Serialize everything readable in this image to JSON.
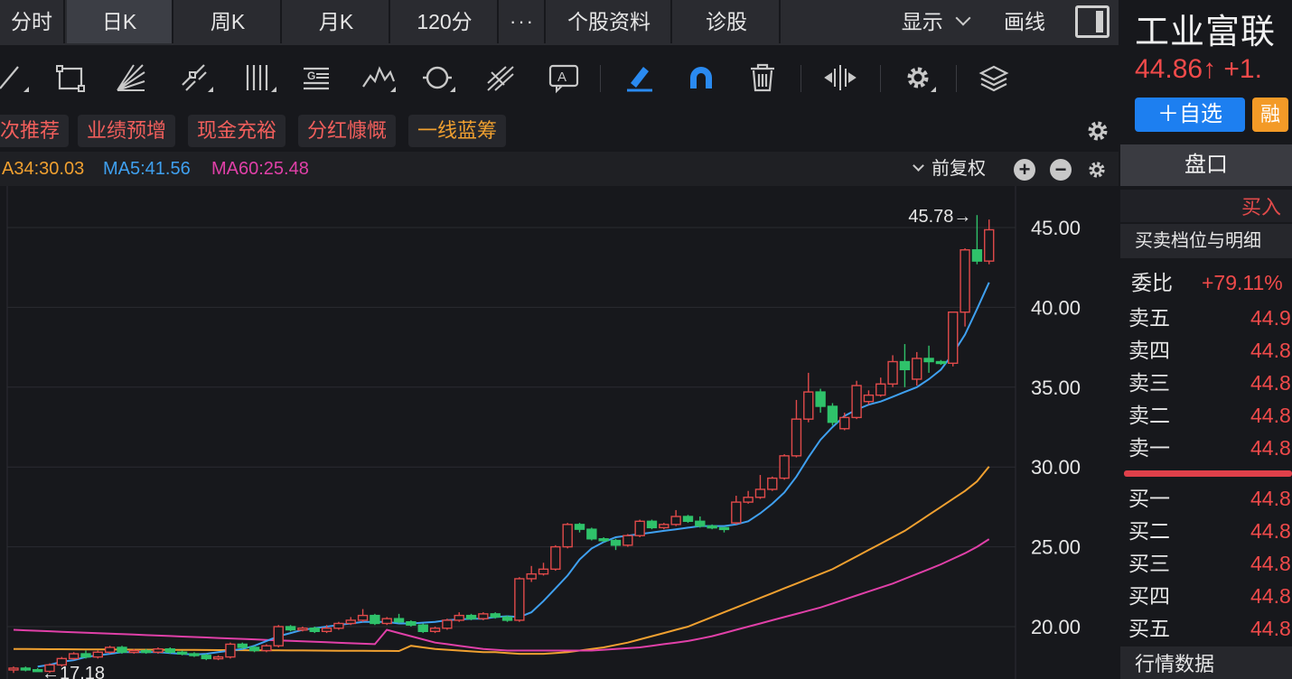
{
  "tabs": [
    {
      "label": "分时",
      "active": false
    },
    {
      "label": "日K",
      "active": true
    },
    {
      "label": "周K",
      "active": false
    },
    {
      "label": "月K",
      "active": false
    },
    {
      "label": "120分",
      "active": false
    },
    {
      "label": "···",
      "active": false
    },
    {
      "label": "个股资料",
      "active": false
    },
    {
      "label": "诊股",
      "active": false
    }
  ],
  "header_right": {
    "show_label": "显示",
    "draw_label": "画线"
  },
  "toolbar": {
    "icons": [
      "line-tool-icon",
      "rectangle-tool-icon",
      "fan-tool-icon",
      "channel-tool-icon",
      "vertical-lines-icon",
      "text-format-icon",
      "wave-tool-icon",
      "cycle-tool-icon",
      "fork-tool-icon",
      "annotation-icon",
      "highlight-pen-icon",
      "magnet-icon",
      "delete-icon",
      "align-icon",
      "settings-icon",
      "layers-icon"
    ]
  },
  "tags": [
    {
      "label": "次推荐",
      "color": "#f25f5c"
    },
    {
      "label": "业绩预增",
      "color": "#f25f5c"
    },
    {
      "label": "现金充裕",
      "color": "#f25f5c"
    },
    {
      "label": "分红慷慨",
      "color": "#f25f5c"
    },
    {
      "label": "一线蓝筹",
      "color": "#f0a030"
    }
  ],
  "ma_legend": [
    {
      "text": "A34:30.03",
      "color": "#f0a030"
    },
    {
      "text": "MA5:41.56",
      "color": "#3fa0f0"
    },
    {
      "text": "MA60:25.48",
      "color": "#e040a8"
    }
  ],
  "adjust_label": "前复权",
  "stock": {
    "name": "工业富联",
    "price_text": "44.86↑ +1.",
    "watch_label": "＋自选",
    "margin_label": "融"
  },
  "orderbook": {
    "panel_title": "盘口",
    "buy_label": "买入",
    "detail_label": "买卖档位与明细",
    "ratio_label": "委比",
    "ratio_value": "+79.11%",
    "asks": [
      {
        "label": "卖五",
        "value": "44.9"
      },
      {
        "label": "卖四",
        "value": "44.8"
      },
      {
        "label": "卖三",
        "value": "44.8"
      },
      {
        "label": "卖二",
        "value": "44.8"
      },
      {
        "label": "卖一",
        "value": "44.8"
      }
    ],
    "bids": [
      {
        "label": "买一",
        "value": "44.8"
      },
      {
        "label": "买二",
        "value": "44.8"
      },
      {
        "label": "买三",
        "value": "44.8"
      },
      {
        "label": "买四",
        "value": "44.8"
      },
      {
        "label": "买五",
        "value": "44.8"
      }
    ],
    "market_data_label": "行情数据"
  },
  "colors": {
    "up": "#e04a4a",
    "down": "#2fc26a",
    "ma5": "#3fa0f0",
    "ma34": "#f0a030",
    "ma60": "#e040a8"
  },
  "chart_data": {
    "type": "candlestick",
    "y_ticks": [
      "45.00",
      "40.00",
      "35.00",
      "30.00",
      "25.00",
      "20.00"
    ],
    "ylim": [
      17,
      46.5
    ],
    "annotations": [
      {
        "text": "45.78→",
        "value": 45.78
      },
      {
        "text": "←17.18",
        "value": 17.18
      }
    ],
    "candles": [
      [
        17.3,
        17.4,
        17.1,
        17.5
      ],
      [
        17.4,
        17.3,
        17.2,
        17.5
      ],
      [
        17.3,
        17.2,
        17.18,
        17.4
      ],
      [
        17.2,
        17.6,
        17.1,
        17.7
      ],
      [
        17.6,
        18.0,
        17.5,
        18.1
      ],
      [
        18.0,
        18.3,
        17.9,
        18.4
      ],
      [
        18.3,
        18.1,
        18.0,
        18.5
      ],
      [
        18.1,
        18.4,
        18.0,
        18.5
      ],
      [
        18.4,
        18.7,
        18.3,
        18.8
      ],
      [
        18.7,
        18.4,
        18.3,
        18.8
      ],
      [
        18.4,
        18.5,
        18.3,
        18.6
      ],
      [
        18.5,
        18.4,
        18.3,
        18.6
      ],
      [
        18.4,
        18.6,
        18.3,
        18.7
      ],
      [
        18.6,
        18.4,
        18.3,
        18.7
      ],
      [
        18.4,
        18.3,
        18.2,
        18.5
      ],
      [
        18.3,
        18.2,
        18.1,
        18.4
      ],
      [
        18.2,
        18.0,
        17.9,
        18.3
      ],
      [
        18.0,
        18.1,
        17.9,
        18.2
      ],
      [
        18.1,
        18.9,
        18.0,
        19.0
      ],
      [
        18.9,
        18.7,
        18.6,
        19.0
      ],
      [
        18.7,
        18.5,
        18.4,
        18.8
      ],
      [
        18.5,
        18.8,
        18.4,
        18.9
      ],
      [
        18.8,
        20.0,
        18.7,
        20.1
      ],
      [
        20.0,
        19.8,
        19.7,
        20.1
      ],
      [
        19.8,
        19.9,
        19.7,
        20.0
      ],
      [
        19.9,
        19.7,
        19.6,
        20.0
      ],
      [
        19.7,
        19.9,
        19.6,
        20.1
      ],
      [
        19.9,
        20.2,
        19.8,
        20.3
      ],
      [
        20.2,
        20.4,
        20.1,
        20.6
      ],
      [
        20.4,
        20.7,
        20.3,
        21.1
      ],
      [
        20.7,
        20.2,
        20.1,
        20.8
      ],
      [
        20.2,
        20.5,
        20.1,
        20.6
      ],
      [
        20.5,
        20.3,
        20.2,
        20.8
      ],
      [
        20.3,
        20.1,
        20.0,
        20.4
      ],
      [
        20.1,
        19.7,
        19.6,
        20.2
      ],
      [
        19.7,
        19.9,
        19.6,
        20.0
      ],
      [
        19.9,
        20.4,
        19.8,
        20.5
      ],
      [
        20.4,
        20.7,
        20.3,
        20.9
      ],
      [
        20.7,
        20.5,
        20.4,
        20.8
      ],
      [
        20.5,
        20.8,
        20.4,
        20.9
      ],
      [
        20.8,
        20.6,
        20.5,
        20.9
      ],
      [
        20.6,
        20.4,
        20.3,
        20.7
      ],
      [
        20.4,
        23.0,
        20.3,
        23.1
      ],
      [
        23.0,
        23.3,
        22.8,
        23.8
      ],
      [
        23.3,
        23.6,
        23.2,
        24.0
      ],
      [
        23.6,
        25.0,
        23.5,
        25.1
      ],
      [
        25.0,
        26.4,
        24.9,
        26.5
      ],
      [
        26.4,
        26.1,
        25.9,
        26.5
      ],
      [
        26.1,
        25.5,
        25.4,
        26.2
      ],
      [
        25.5,
        25.4,
        25.3,
        25.6
      ],
      [
        25.4,
        25.1,
        24.8,
        25.5
      ],
      [
        25.1,
        25.7,
        25.0,
        25.8
      ],
      [
        25.7,
        26.6,
        25.6,
        26.7
      ],
      [
        26.6,
        26.2,
        26.1,
        26.7
      ],
      [
        26.2,
        26.4,
        26.1,
        26.5
      ],
      [
        26.4,
        26.9,
        26.3,
        27.3
      ],
      [
        26.9,
        26.6,
        26.5,
        27.0
      ],
      [
        26.6,
        26.3,
        26.2,
        26.9
      ],
      [
        26.3,
        26.2,
        26.1,
        26.4
      ],
      [
        26.2,
        26.1,
        25.9,
        26.2
      ],
      [
        26.5,
        27.8,
        26.4,
        28.2
      ],
      [
        27.8,
        28.1,
        27.7,
        28.5
      ],
      [
        28.1,
        28.6,
        28.0,
        29.5
      ],
      [
        28.6,
        29.3,
        28.5,
        29.4
      ],
      [
        29.3,
        30.7,
        29.2,
        30.8
      ],
      [
        30.7,
        33.0,
        30.6,
        34.2
      ],
      [
        33.0,
        34.7,
        32.8,
        35.9
      ],
      [
        34.7,
        33.8,
        33.4,
        34.9
      ],
      [
        33.8,
        32.8,
        32.6,
        34.0
      ],
      [
        32.4,
        33.1,
        32.3,
        33.4
      ],
      [
        33.1,
        35.1,
        33.0,
        35.4
      ],
      [
        34.1,
        34.5,
        33.9,
        34.8
      ],
      [
        34.5,
        35.2,
        34.4,
        35.6
      ],
      [
        35.2,
        36.6,
        35.0,
        37.0
      ],
      [
        36.6,
        36.1,
        35.0,
        37.7
      ],
      [
        35.5,
        36.8,
        35.1,
        37.2
      ],
      [
        36.8,
        36.6,
        35.9,
        37.6
      ],
      [
        36.6,
        36.5,
        36.4,
        36.7
      ],
      [
        36.5,
        39.7,
        36.3,
        39.7
      ],
      [
        39.7,
        43.6,
        38.8,
        43.7
      ],
      [
        43.6,
        42.9,
        42.7,
        45.78
      ],
      [
        42.9,
        44.86,
        42.7,
        45.5
      ]
    ],
    "ma5": [
      17.5,
      17.6,
      17.8,
      17.9,
      18.1,
      18.2,
      18.3,
      18.4,
      18.4,
      18.4,
      18.4,
      18.35,
      18.3,
      18.25,
      18.3,
      18.4,
      18.5,
      18.6,
      18.8,
      19.1,
      19.4,
      19.6,
      19.8,
      19.9,
      20.0,
      20.1,
      20.2,
      20.3,
      20.3,
      20.3,
      20.2,
      20.2,
      20.25,
      20.3,
      20.4,
      20.45,
      20.5,
      20.5,
      20.6,
      20.65,
      20.6,
      20.9,
      21.6,
      22.4,
      23.2,
      24.2,
      24.9,
      25.3,
      25.6,
      25.7,
      25.8,
      25.9,
      26.0,
      26.1,
      26.2,
      26.3,
      26.3,
      26.3,
      26.4,
      26.6,
      27.1,
      27.7,
      28.4,
      29.4,
      30.6,
      31.7,
      32.5,
      33.2,
      33.6,
      33.9,
      34.1,
      34.4,
      34.7,
      35.0,
      35.5,
      36.1,
      37.1,
      38.3,
      39.9,
      41.56
    ],
    "ma34": [
      18.8,
      18.7,
      18.6,
      18.55,
      18.5,
      18.45,
      18.4,
      18.4,
      18.35,
      18.3,
      18.3,
      18.3,
      18.35,
      18.4,
      18.5,
      18.6,
      18.7,
      18.85,
      19.0,
      19.2,
      19.4,
      19.6,
      19.8,
      20.0,
      20.3,
      20.6,
      20.9,
      21.2,
      21.5,
      21.8,
      22.1,
      22.4,
      22.7,
      23.0,
      23.3,
      23.6,
      24.0,
      24.4,
      24.8,
      25.2,
      25.6,
      26.0,
      26.5,
      27.0,
      27.5,
      28.0,
      28.5,
      29.1,
      30.03
    ],
    "ma60": [
      19.8,
      19.6,
      19.4,
      19.2,
      19.0,
      18.9,
      18.8,
      18.7,
      18.6,
      18.55,
      18.5,
      18.5,
      18.5,
      18.5,
      18.5,
      18.5,
      18.5,
      18.5,
      18.55,
      18.6,
      18.65,
      18.7,
      18.8,
      18.9,
      19.0,
      19.1,
      19.25,
      19.4,
      19.6,
      19.8,
      20.0,
      20.2,
      20.4,
      20.6,
      20.8,
      21.0,
      21.2,
      21.45,
      21.7,
      21.95,
      22.2,
      22.45,
      22.7,
      23.0,
      23.3,
      23.6,
      23.9,
      24.25,
      24.6,
      25.0,
      25.48
    ]
  }
}
